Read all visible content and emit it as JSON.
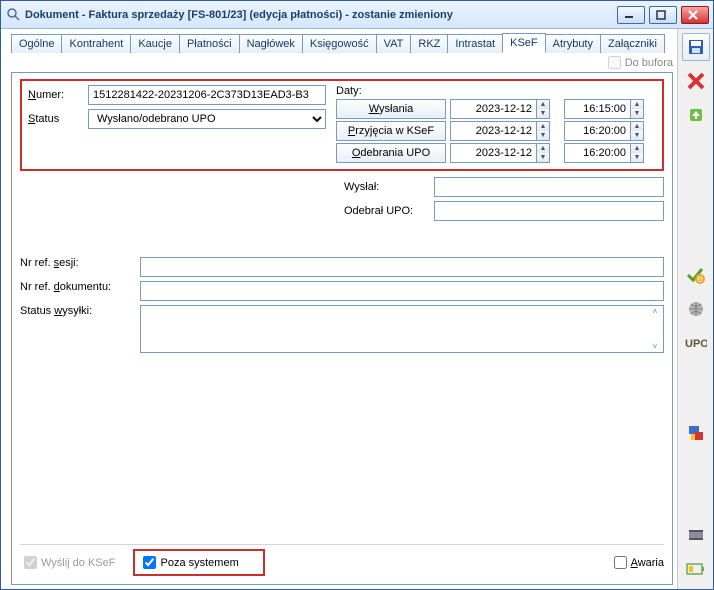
{
  "window_title": "Dokument - Faktura sprzedaży [FS-801/23] (edycja płatności) - zostanie zmieniony",
  "tabs": [
    "Ogólne",
    "Kontrahent",
    "Kaucje",
    "Płatności",
    "Nagłówek",
    "Księgowość",
    "VAT",
    "RKZ",
    "Intrastat",
    "KSeF",
    "Atrybuty",
    "Załączniki"
  ],
  "active_tab": "KSeF",
  "do_bufora": "Do bufora",
  "numer_label": "Numer:",
  "numer_value": "1512281422-20231206-2C373D13EAD3-B3",
  "status_label": "Status",
  "status_value": "Wysłano/odebrano UPO",
  "daty_label": "Daty:",
  "date_rows": [
    {
      "btn": "Wysłania",
      "date": "2023-12-12",
      "time": "16:15:00"
    },
    {
      "btn": "Przyjęcia w KSeF",
      "date": "2023-12-12",
      "time": "16:20:00"
    },
    {
      "btn": "Odebrania UPO",
      "date": "2023-12-12",
      "time": "16:20:00"
    }
  ],
  "wyslal_label": "Wysłał:",
  "wyslal_value": "",
  "odebral_label": "Odebrał UPO:",
  "odebral_value": "",
  "nr_ref_ses": "Nr ref. sesji:",
  "nr_ref_dok": "Nr ref. dokumentu:",
  "status_wys": "Status wysyłki:",
  "cb_wyslij": "Wyślij do KSeF",
  "cb_poza": "Poza systemem",
  "cb_awaria": "Awaria"
}
